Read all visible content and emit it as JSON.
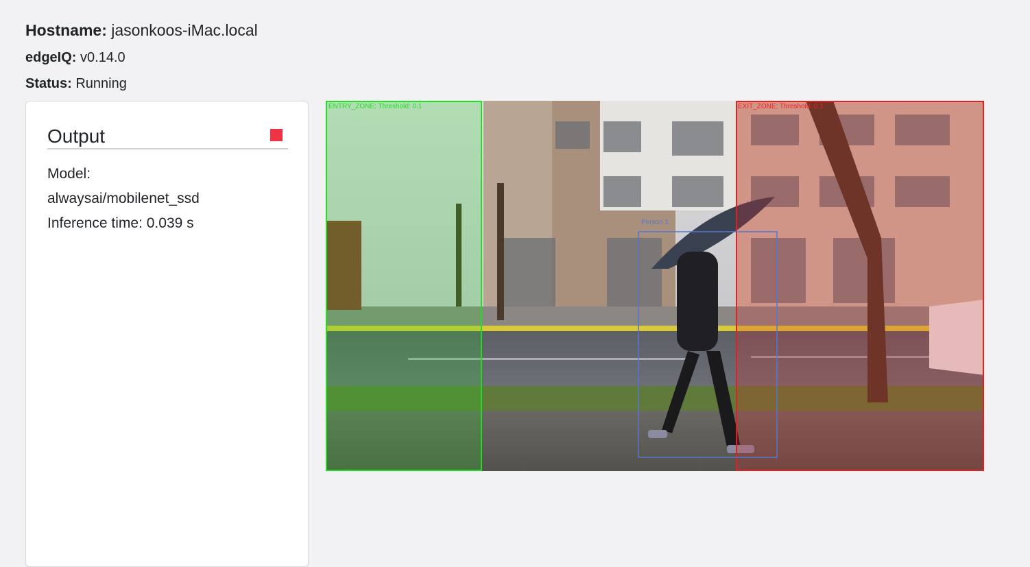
{
  "info": {
    "hostname_label": "Hostname:",
    "hostname_value": "jasonkoos-iMac.local",
    "edgeiq_label": "edgeIQ:",
    "edgeiq_value": "v0.14.0",
    "status_label": "Status:",
    "status_value": "Running"
  },
  "output": {
    "title": "Output",
    "model_label": "Model:",
    "model_value": "alwaysai/mobilenet_ssd",
    "inference_label": "Inference time:",
    "inference_value": "0.039 s"
  },
  "frame": {
    "entry_zone_label": "ENTRY_ZONE: Threshold: 0.1",
    "exit_zone_label": "EXIT_ZONE: Threshold: 0.1",
    "person_label": "Person 1",
    "entry_color": "#22dd22",
    "exit_color": "#ee2222",
    "person_color": "#5577cc"
  },
  "colors": {
    "stop_button": "#ee3344"
  }
}
